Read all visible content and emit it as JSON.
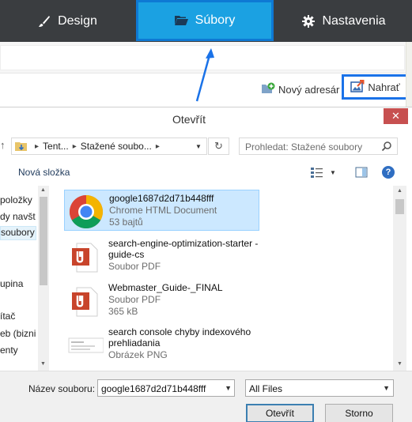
{
  "nav": {
    "tabs": [
      {
        "label": "Design",
        "icon": "brush-icon"
      },
      {
        "label": "Súbory",
        "icon": "folder-open-icon"
      },
      {
        "label": "Nastavenia",
        "icon": "gear-icon"
      }
    ],
    "active_tab": "Súbory"
  },
  "toolbar": {
    "new_folder_label": "Nový adresár",
    "upload_label": "Nahrať"
  },
  "dialog": {
    "title": "Otevřít",
    "close_glyph": "✕",
    "address": {
      "segments": [
        "Tent...",
        "Stažené soubo..."
      ]
    },
    "search_placeholder": "Prohledat: Stažené soubory",
    "new_folder_cmd": "Nová složka",
    "help_glyph": "?",
    "nav_items": [
      {
        "label": "položky"
      },
      {
        "label": "dy navšt"
      },
      {
        "label": "soubory",
        "selected": true
      },
      {
        "label": "upina"
      },
      {
        "label": "ítač"
      },
      {
        "label": "eb (bizni"
      },
      {
        "label": "enty"
      }
    ],
    "files": [
      {
        "name": "google1687d2d71b448fff",
        "type": "Chrome HTML Document",
        "size": "53 bajtů",
        "icon": "chrome-icon",
        "selected": true
      },
      {
        "name": "search-engine-optimization-starter -guide-cs",
        "type": "Soubor PDF",
        "size": "",
        "icon": "pdf-icon"
      },
      {
        "name": "Webmaster_Guide-_FINAL",
        "type": "Soubor PDF",
        "size": "365 kB",
        "icon": "pdf-icon"
      },
      {
        "name": "search console chyby indexového prehliadania",
        "type": "Obrázek PNG",
        "size": "",
        "icon": "image-icon"
      }
    ],
    "filename_label": "Název souboru:",
    "filename_value": "google1687d2d71b448fff",
    "filetype_value": "All Files",
    "open_label": "Otevřít",
    "cancel_label": "Storno"
  },
  "colors": {
    "nav_bg": "#3a3d40",
    "active_tab_bg": "#1ba1e2",
    "highlight_border": "#1a72e8",
    "selection_bg": "#cce8ff"
  }
}
